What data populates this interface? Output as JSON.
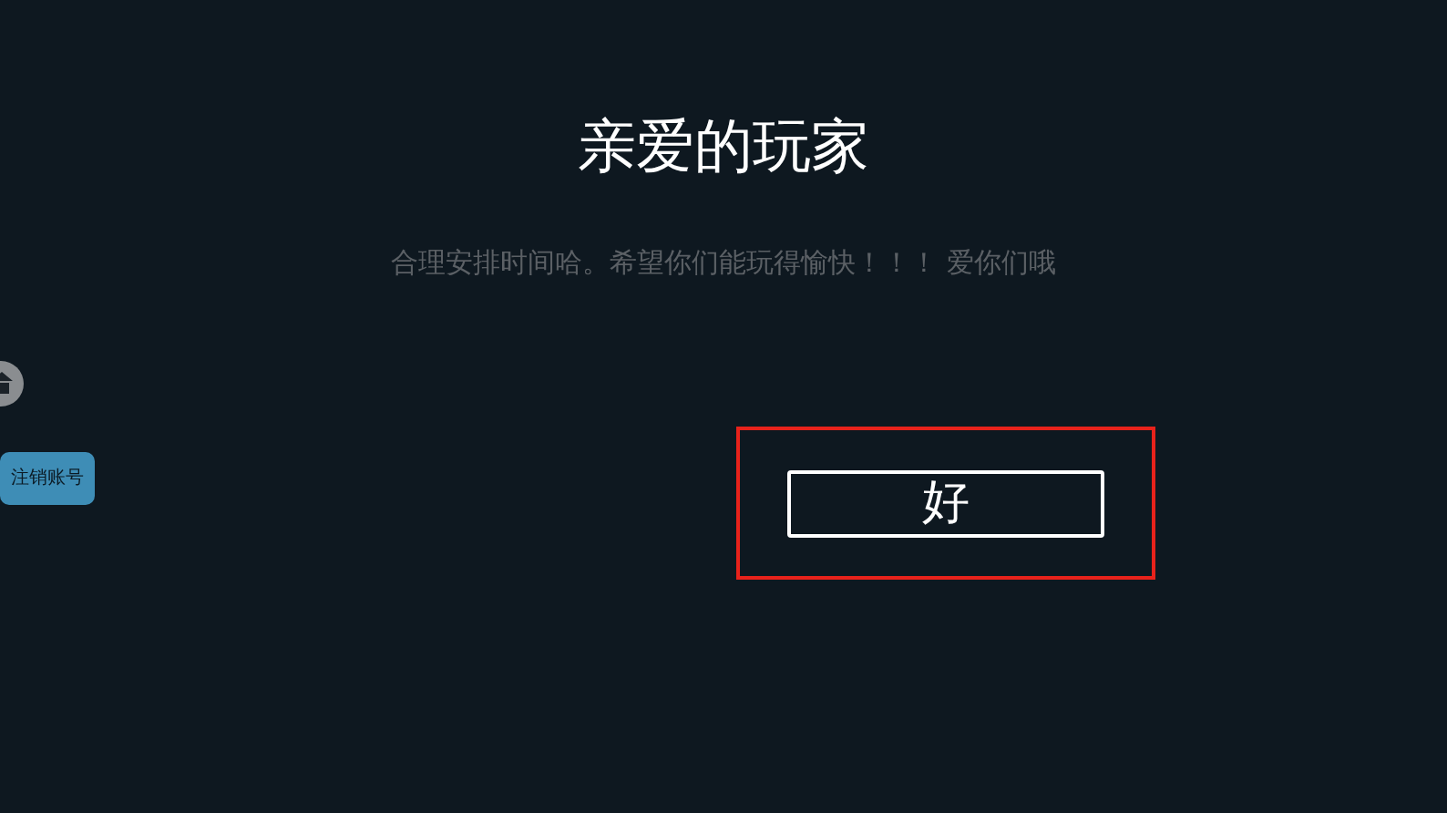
{
  "dialog": {
    "title": "亲爱的玩家",
    "message": "合理安排时间哈。希望你们能玩得愉快！！！ 爱你们哦",
    "confirm_button": {
      "label": "好",
      "highlighted": true
    }
  },
  "side_buttons": [
    {
      "label": "注销账号"
    }
  ]
}
